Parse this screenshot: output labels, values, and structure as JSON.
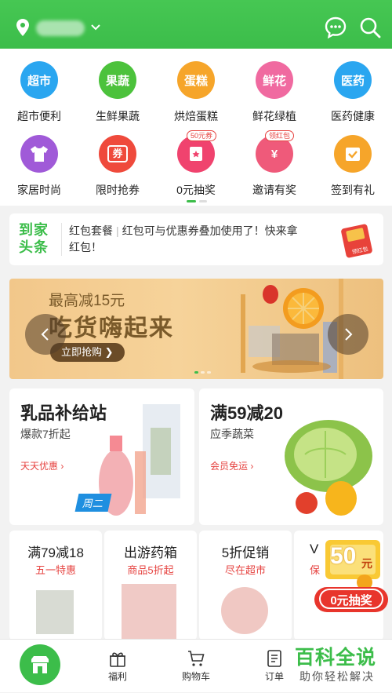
{
  "header": {
    "location_icon": "location-pin-icon",
    "message_icon": "message-icon",
    "search_icon": "search-icon"
  },
  "categories": [
    {
      "icon_text": "超市",
      "label": "超市便利",
      "color": "#2aa6f0"
    },
    {
      "icon_text": "果蔬",
      "label": "生鲜果蔬",
      "color": "#4cc23c"
    },
    {
      "icon_text": "蛋糕",
      "label": "烘焙蛋糕",
      "color": "#f6a52a"
    },
    {
      "icon_text": "鲜花",
      "label": "鲜花绿植",
      "color": "#f06aa0"
    },
    {
      "icon_text": "医药",
      "label": "医药健康",
      "color": "#2aa6f0"
    },
    {
      "icon_text": "",
      "label": "家居时尚",
      "color": "#a05ad8"
    },
    {
      "icon_text": "券",
      "label": "限时抢券",
      "color": "#ef4a3c"
    },
    {
      "icon_text": "",
      "label": "0元抽奖",
      "color": "#f0436e",
      "tag": "50元券"
    },
    {
      "icon_text": "¥",
      "label": "邀请有奖",
      "color": "#ef5a7a",
      "tag": "领红包"
    },
    {
      "icon_text": "",
      "label": "签到有礼",
      "color": "#f6a52a"
    }
  ],
  "news": {
    "brand_line1": "到家",
    "brand_line2": "头条",
    "tag": "红包套餐",
    "text": "红包可与优惠券叠加使用了！快来拿红包！",
    "redpack_label": "领红包"
  },
  "banner": {
    "subtitle": "最高减15元",
    "title": "吃货嗨起来",
    "button": "立即抢购 ❯"
  },
  "cards": {
    "dairy": {
      "title": "乳品补给站",
      "sub": "爆款7折起",
      "link": "天天优惠 ›",
      "badge": "周二"
    },
    "veg": {
      "title": "满59减20",
      "sub": "应季蔬菜",
      "link": "会员免运 ›"
    }
  },
  "small_cards": [
    {
      "title": "满79减18",
      "sub": "五一特惠"
    },
    {
      "title": "出游药箱",
      "sub": "商品5折起"
    },
    {
      "title": "5折促销",
      "sub": "尽在超市"
    },
    {
      "title": "V",
      "sub": "保"
    }
  ],
  "lottery": {
    "amount": "50",
    "unit": "元",
    "button": "0元抽奖"
  },
  "tabbar": [
    {
      "label": "福利",
      "icon": "gift-icon"
    },
    {
      "label": "购物车",
      "icon": "cart-icon"
    },
    {
      "label": "订单",
      "icon": "order-icon"
    }
  ],
  "watermark": {
    "line1": "百科全说",
    "line2": "助你轻松解决"
  }
}
